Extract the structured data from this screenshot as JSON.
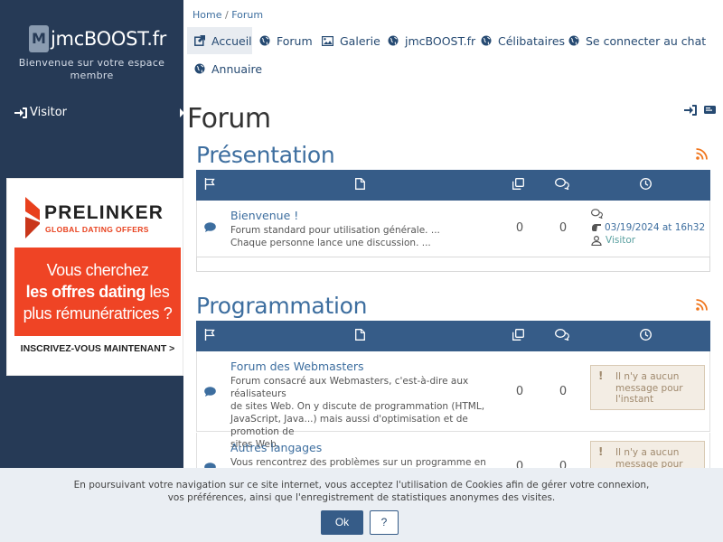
{
  "sidebar": {
    "logo_mark": "M",
    "logo_text": "jmcBOOST.fr",
    "tagline_line1": "Bienvenue sur votre espace",
    "tagline_line2": "membre",
    "visitor_label": "Visitor"
  },
  "ad": {
    "brand": "PRELINKER",
    "brand_sub": "GLOBAL DATING OFFERS",
    "line1": "Vous cherchez",
    "line2_bold": "les offres dating",
    "line2_rest": " les",
    "line3": "plus rémunératrices ?",
    "cta": "INSCRIVEZ-VOUS MAINTENANT >"
  },
  "breadcrumb": {
    "home": "Home",
    "separator": " / ",
    "current": "Forum"
  },
  "nav": {
    "items": [
      {
        "label": "Accueil",
        "icon": "external-link-icon"
      },
      {
        "label": "Forum",
        "icon": "globe-icon"
      },
      {
        "label": "Galerie",
        "icon": "image-icon"
      },
      {
        "label": "jmcBOOST.fr",
        "icon": "globe-icon"
      },
      {
        "label": "Célibataires",
        "icon": "globe-icon"
      },
      {
        "label": "Se connecter au chat",
        "icon": "globe-icon"
      },
      {
        "label": "Annuaire",
        "icon": "globe-icon"
      }
    ]
  },
  "page": {
    "title": "Forum"
  },
  "sections": [
    {
      "title": "Présentation",
      "forums": [
        {
          "name": "Bienvenue !",
          "desc_line1": "Forum standard pour utilisation générale. ...",
          "desc_line2": "Chaque personne lance une discussion. ...",
          "topics": "0",
          "posts": "0",
          "last_date": "03/19/2024 at 16h32",
          "last_user": "Visitor"
        }
      ]
    },
    {
      "title": "Programmation",
      "forums": [
        {
          "name": "Forum des Webmasters",
          "desc_line1": "Forum consacré aux Webmasters, c'est-à-dire aux réalisateurs",
          "desc_line2": "de sites Web. On y discute de programmation (HTML,",
          "desc_line3": "JavaScript, Java...) mais aussi d'optimisation et de promotion de",
          "desc_line4": "sites Web.",
          "topics": "0",
          "posts": "0",
          "empty_msg": "Il n'y a aucun message pour l'instant"
        },
        {
          "name": "Autres langages",
          "desc_line1": "Vous rencontrez des problèmes sur un programme en Java, en",
          "topics": "0",
          "posts": "0",
          "empty_msg": "Il n'y a aucun message pour l'instant"
        }
      ]
    }
  ],
  "warning_mark": "!",
  "cookie": {
    "line1": "En poursuivant votre navigation sur ce site internet, vous acceptez l'utilisation de Cookies afin de gérer votre connexion,",
    "line2": "vos préférences, ainsi que l'enregistrement de statistiques anonymes des visites.",
    "ok_label": "Ok",
    "help_label": "?"
  },
  "colors": {
    "sidebar_bg": "#263a56",
    "header_bar": "#365c88",
    "link": "#3d6e9f",
    "rss": "#f0761d",
    "ad_red": "#ef4425"
  }
}
